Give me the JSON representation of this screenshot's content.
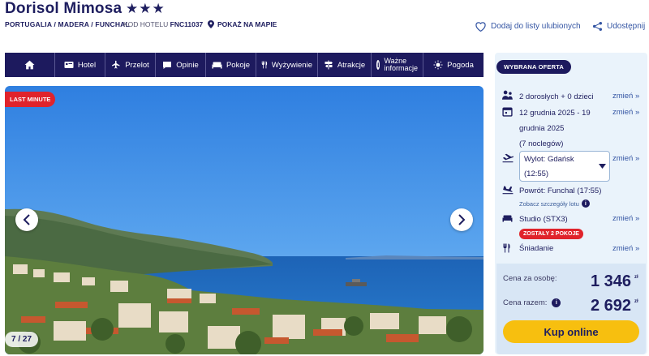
{
  "header": {
    "hotel_name": "Dorisol Mimosa",
    "stars": "★★★",
    "breadcrumb": "PORTUGALIA / MADERA / FUNCHAL",
    "hotel_code_label": "KOD HOTELU",
    "hotel_code": "FNC11037",
    "map_link": "POKAŻ NA MAPIE",
    "favorite_link": "Dodaj do listy ulubionych",
    "share_link": "Udostępnij"
  },
  "nav": {
    "items": [
      {
        "label": "",
        "icon": "home-icon"
      },
      {
        "label": "Hotel",
        "icon": "hotel-icon"
      },
      {
        "label": "Przelot",
        "icon": "plane-icon"
      },
      {
        "label": "Opinie",
        "icon": "chat-icon"
      },
      {
        "label": "Pokoje",
        "icon": "bed-icon"
      },
      {
        "label": "Wyżywienie",
        "icon": "cutlery-icon"
      },
      {
        "label": "Atrakcje",
        "icon": "signpost-icon"
      },
      {
        "label": "Ważne",
        "label2": "informacje",
        "icon": "info-icon"
      },
      {
        "label": "Pogoda",
        "icon": "sun-icon"
      }
    ]
  },
  "gallery": {
    "badge": "LAST MINUTE",
    "counter": "7 / 27"
  },
  "offer": {
    "tag": "WYBRANA OFERTA",
    "travelers": "2 dorosłych + 0 dzieci",
    "dates_line1": "12 grudnia 2025 - 19",
    "dates_line2": "grudnia 2025",
    "nights": "(7 noclegów)",
    "departure_line1": "Wylot: Gdańsk",
    "departure_line2": "(12:55)",
    "return": "Powrót: Funchal (17:55)",
    "flight_details": "Zobacz szczegóły lotu",
    "room": "Studio (STX3)",
    "rooms_left": "ZOSTAŁY 2 POKOJE",
    "board": "Śniadanie",
    "change_label": "zmień »"
  },
  "price": {
    "per_person_label": "Cena za osobę:",
    "per_person": "1 346",
    "total_label": "Cena razem:",
    "total": "2 692",
    "currency": "zł",
    "buy_button": "Kup online"
  },
  "colors": {
    "navy": "#1d1a5e",
    "accent_red": "#e0232b",
    "cta_yellow": "#f7bf0f",
    "link_blue": "#3455a3"
  }
}
